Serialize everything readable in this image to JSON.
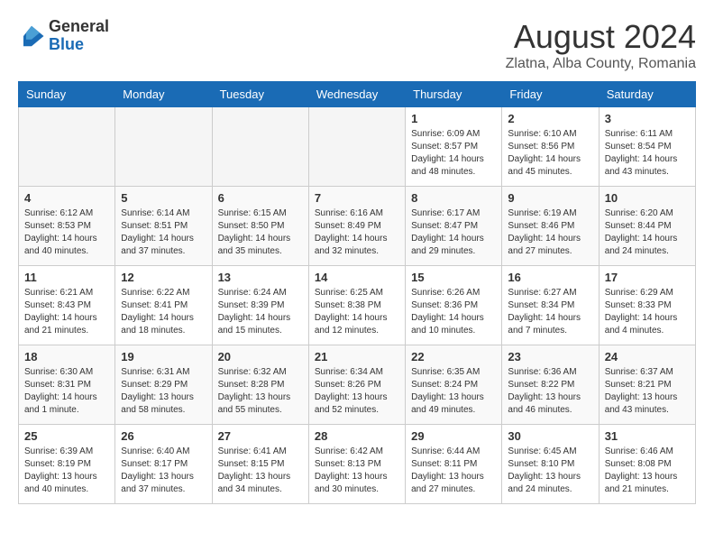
{
  "header": {
    "logo": {
      "general": "General",
      "blue": "Blue"
    },
    "month_year": "August 2024",
    "location": "Zlatna, Alba County, Romania"
  },
  "days_of_week": [
    "Sunday",
    "Monday",
    "Tuesday",
    "Wednesday",
    "Thursday",
    "Friday",
    "Saturday"
  ],
  "weeks": [
    [
      {
        "day": "",
        "info": ""
      },
      {
        "day": "",
        "info": ""
      },
      {
        "day": "",
        "info": ""
      },
      {
        "day": "",
        "info": ""
      },
      {
        "day": "1",
        "info": "Sunrise: 6:09 AM\nSunset: 8:57 PM\nDaylight: 14 hours\nand 48 minutes."
      },
      {
        "day": "2",
        "info": "Sunrise: 6:10 AM\nSunset: 8:56 PM\nDaylight: 14 hours\nand 45 minutes."
      },
      {
        "day": "3",
        "info": "Sunrise: 6:11 AM\nSunset: 8:54 PM\nDaylight: 14 hours\nand 43 minutes."
      }
    ],
    [
      {
        "day": "4",
        "info": "Sunrise: 6:12 AM\nSunset: 8:53 PM\nDaylight: 14 hours\nand 40 minutes."
      },
      {
        "day": "5",
        "info": "Sunrise: 6:14 AM\nSunset: 8:51 PM\nDaylight: 14 hours\nand 37 minutes."
      },
      {
        "day": "6",
        "info": "Sunrise: 6:15 AM\nSunset: 8:50 PM\nDaylight: 14 hours\nand 35 minutes."
      },
      {
        "day": "7",
        "info": "Sunrise: 6:16 AM\nSunset: 8:49 PM\nDaylight: 14 hours\nand 32 minutes."
      },
      {
        "day": "8",
        "info": "Sunrise: 6:17 AM\nSunset: 8:47 PM\nDaylight: 14 hours\nand 29 minutes."
      },
      {
        "day": "9",
        "info": "Sunrise: 6:19 AM\nSunset: 8:46 PM\nDaylight: 14 hours\nand 27 minutes."
      },
      {
        "day": "10",
        "info": "Sunrise: 6:20 AM\nSunset: 8:44 PM\nDaylight: 14 hours\nand 24 minutes."
      }
    ],
    [
      {
        "day": "11",
        "info": "Sunrise: 6:21 AM\nSunset: 8:43 PM\nDaylight: 14 hours\nand 21 minutes."
      },
      {
        "day": "12",
        "info": "Sunrise: 6:22 AM\nSunset: 8:41 PM\nDaylight: 14 hours\nand 18 minutes."
      },
      {
        "day": "13",
        "info": "Sunrise: 6:24 AM\nSunset: 8:39 PM\nDaylight: 14 hours\nand 15 minutes."
      },
      {
        "day": "14",
        "info": "Sunrise: 6:25 AM\nSunset: 8:38 PM\nDaylight: 14 hours\nand 12 minutes."
      },
      {
        "day": "15",
        "info": "Sunrise: 6:26 AM\nSunset: 8:36 PM\nDaylight: 14 hours\nand 10 minutes."
      },
      {
        "day": "16",
        "info": "Sunrise: 6:27 AM\nSunset: 8:34 PM\nDaylight: 14 hours\nand 7 minutes."
      },
      {
        "day": "17",
        "info": "Sunrise: 6:29 AM\nSunset: 8:33 PM\nDaylight: 14 hours\nand 4 minutes."
      }
    ],
    [
      {
        "day": "18",
        "info": "Sunrise: 6:30 AM\nSunset: 8:31 PM\nDaylight: 14 hours\nand 1 minute."
      },
      {
        "day": "19",
        "info": "Sunrise: 6:31 AM\nSunset: 8:29 PM\nDaylight: 13 hours\nand 58 minutes."
      },
      {
        "day": "20",
        "info": "Sunrise: 6:32 AM\nSunset: 8:28 PM\nDaylight: 13 hours\nand 55 minutes."
      },
      {
        "day": "21",
        "info": "Sunrise: 6:34 AM\nSunset: 8:26 PM\nDaylight: 13 hours\nand 52 minutes."
      },
      {
        "day": "22",
        "info": "Sunrise: 6:35 AM\nSunset: 8:24 PM\nDaylight: 13 hours\nand 49 minutes."
      },
      {
        "day": "23",
        "info": "Sunrise: 6:36 AM\nSunset: 8:22 PM\nDaylight: 13 hours\nand 46 minutes."
      },
      {
        "day": "24",
        "info": "Sunrise: 6:37 AM\nSunset: 8:21 PM\nDaylight: 13 hours\nand 43 minutes."
      }
    ],
    [
      {
        "day": "25",
        "info": "Sunrise: 6:39 AM\nSunset: 8:19 PM\nDaylight: 13 hours\nand 40 minutes."
      },
      {
        "day": "26",
        "info": "Sunrise: 6:40 AM\nSunset: 8:17 PM\nDaylight: 13 hours\nand 37 minutes."
      },
      {
        "day": "27",
        "info": "Sunrise: 6:41 AM\nSunset: 8:15 PM\nDaylight: 13 hours\nand 34 minutes."
      },
      {
        "day": "28",
        "info": "Sunrise: 6:42 AM\nSunset: 8:13 PM\nDaylight: 13 hours\nand 30 minutes."
      },
      {
        "day": "29",
        "info": "Sunrise: 6:44 AM\nSunset: 8:11 PM\nDaylight: 13 hours\nand 27 minutes."
      },
      {
        "day": "30",
        "info": "Sunrise: 6:45 AM\nSunset: 8:10 PM\nDaylight: 13 hours\nand 24 minutes."
      },
      {
        "day": "31",
        "info": "Sunrise: 6:46 AM\nSunset: 8:08 PM\nDaylight: 13 hours\nand 21 minutes."
      }
    ]
  ]
}
